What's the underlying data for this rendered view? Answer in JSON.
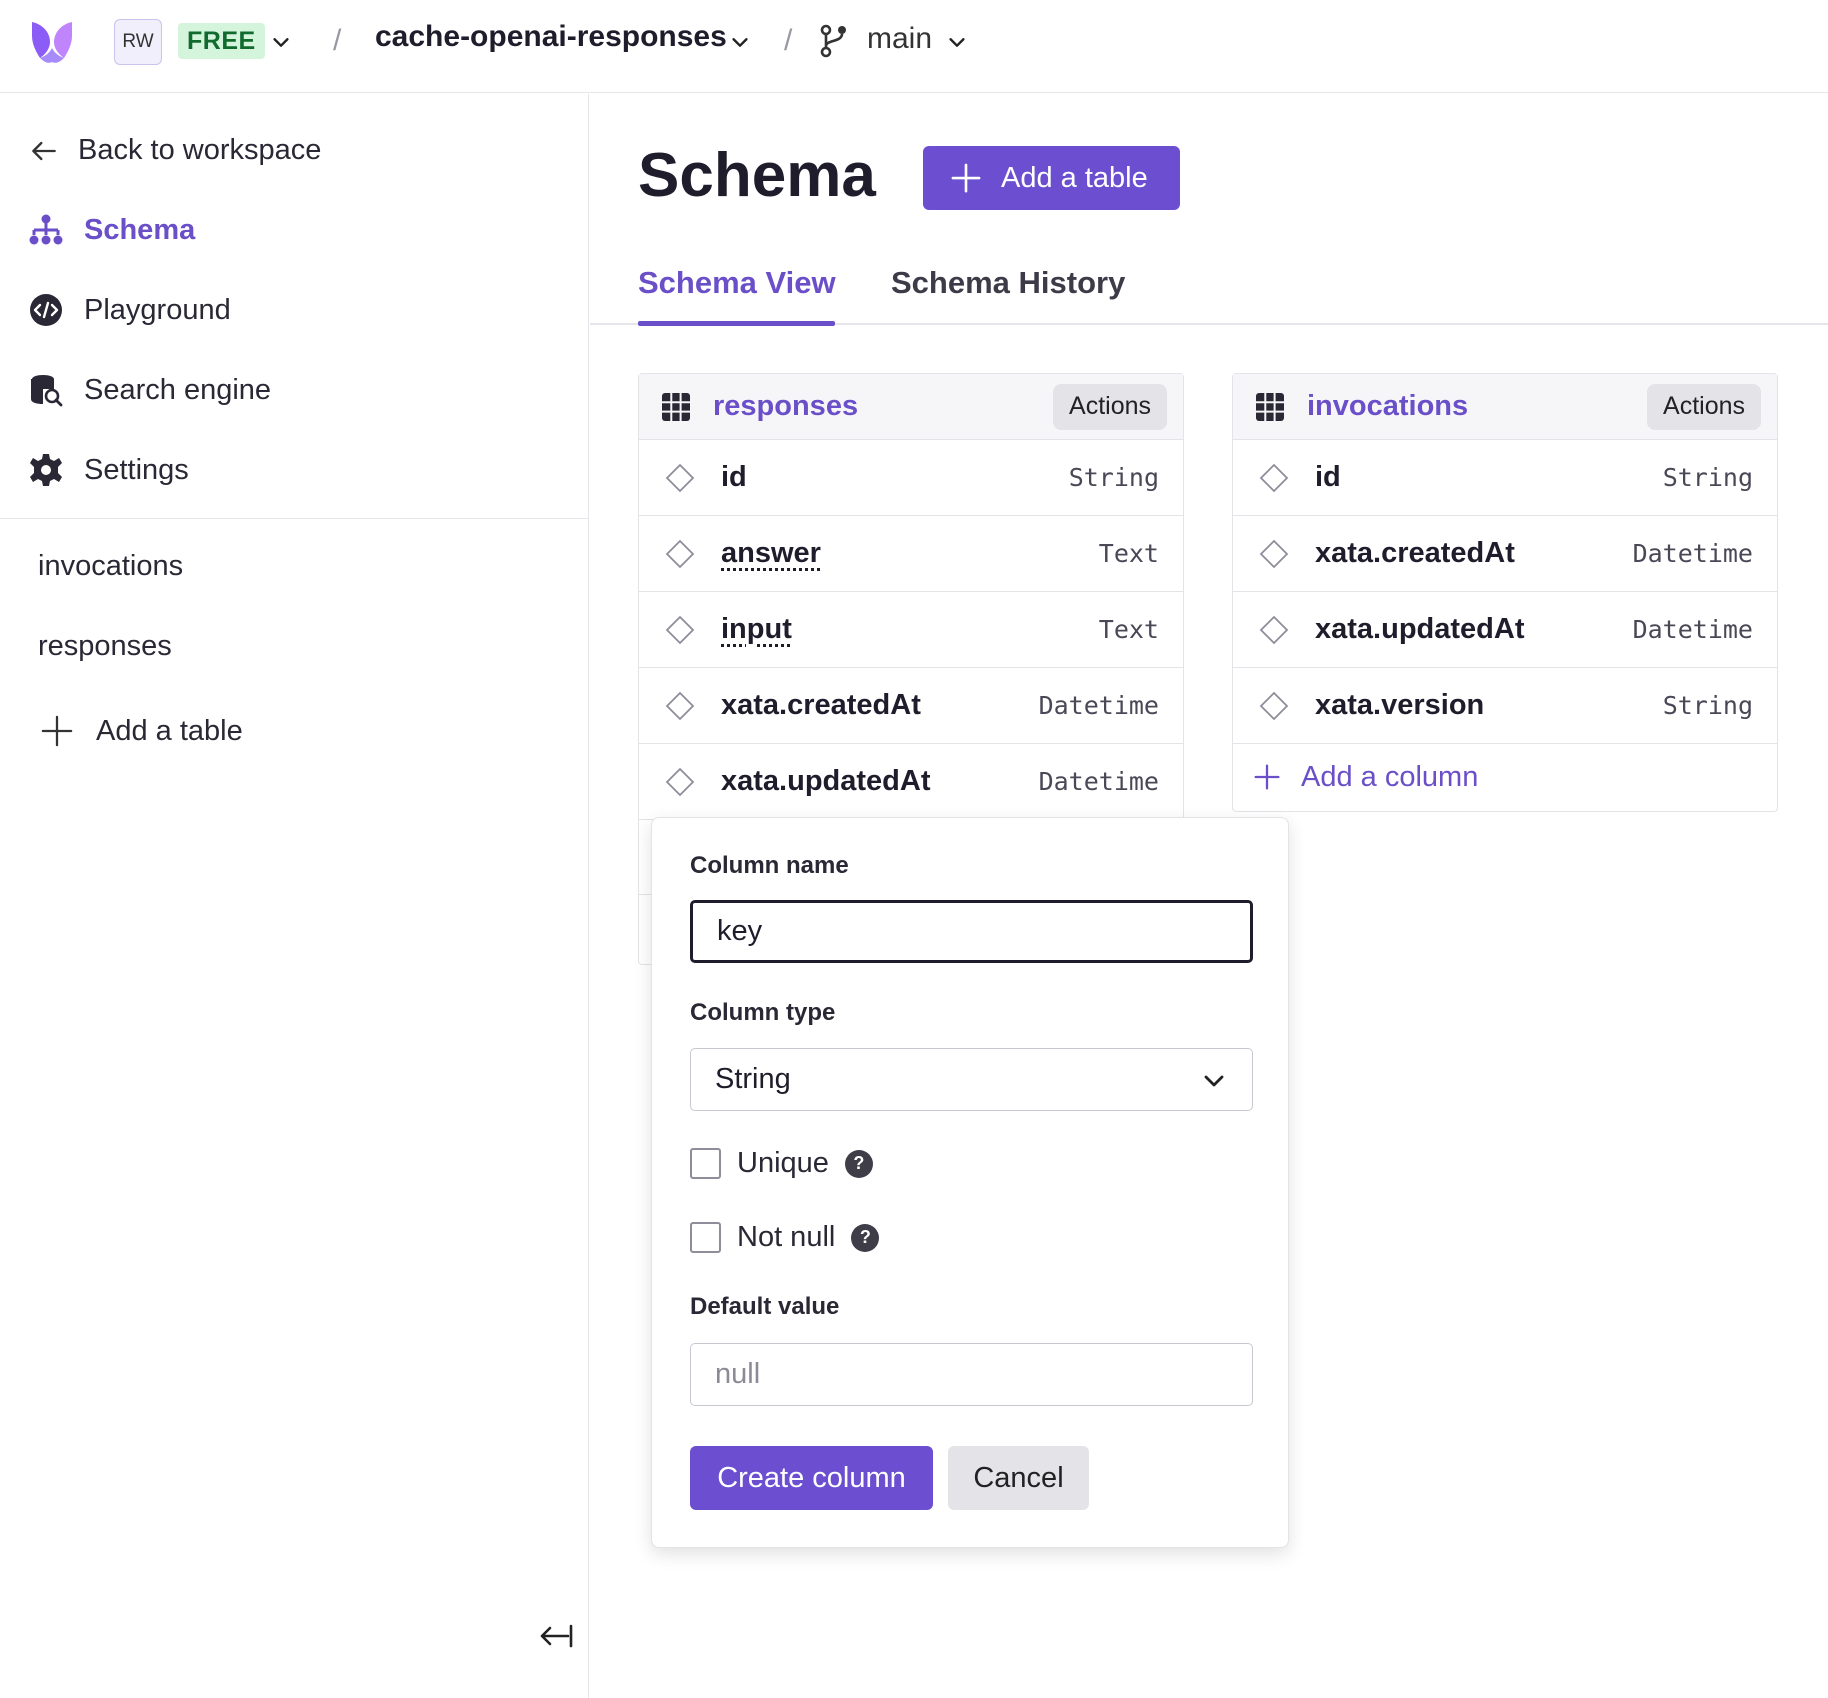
{
  "topbar": {
    "workspace_initials": "RW",
    "plan_badge": "FREE",
    "database_name": "cache-openai-responses",
    "branch_name": "main",
    "separator": "/"
  },
  "sidebar": {
    "back_label": "Back to workspace",
    "nav": [
      {
        "label": "Schema",
        "icon": "schema-icon",
        "active": true
      },
      {
        "label": "Playground",
        "icon": "code-icon",
        "active": false
      },
      {
        "label": "Search engine",
        "icon": "database-search-icon",
        "active": false
      },
      {
        "label": "Settings",
        "icon": "gear-icon",
        "active": false
      }
    ],
    "tables": [
      "invocations",
      "responses"
    ],
    "add_table_label": "Add a table"
  },
  "main": {
    "title": "Schema",
    "add_table_button": "Add a table",
    "tabs": [
      {
        "label": "Schema View",
        "active": true
      },
      {
        "label": "Schema History",
        "active": false
      }
    ]
  },
  "tables": [
    {
      "name": "responses",
      "actions_label": "Actions",
      "columns": [
        {
          "name": "id",
          "type": "String"
        },
        {
          "name": "answer",
          "type": "Text"
        },
        {
          "name": "input",
          "type": "Text"
        },
        {
          "name": "xata.createdAt",
          "type": "Datetime"
        },
        {
          "name": "xata.updatedAt",
          "type": "Datetime"
        }
      ]
    },
    {
      "name": "invocations",
      "actions_label": "Actions",
      "columns": [
        {
          "name": "id",
          "type": "String"
        },
        {
          "name": "xata.createdAt",
          "type": "Datetime"
        },
        {
          "name": "xata.updatedAt",
          "type": "Datetime"
        },
        {
          "name": "xata.version",
          "type": "String"
        }
      ],
      "add_column_label": "Add a column"
    }
  ],
  "column_form": {
    "name_label": "Column name",
    "name_value": "key",
    "type_label": "Column type",
    "type_value": "String",
    "unique_label": "Unique",
    "unique_checked": false,
    "not_null_label": "Not null",
    "not_null_checked": false,
    "help_glyph": "?",
    "default_label": "Default value",
    "default_placeholder": "null",
    "create_button": "Create column",
    "cancel_button": "Cancel"
  },
  "colors": {
    "accent": "#6b4fd0",
    "badge_bg": "#d4f4dc",
    "badge_text": "#116b2f"
  }
}
